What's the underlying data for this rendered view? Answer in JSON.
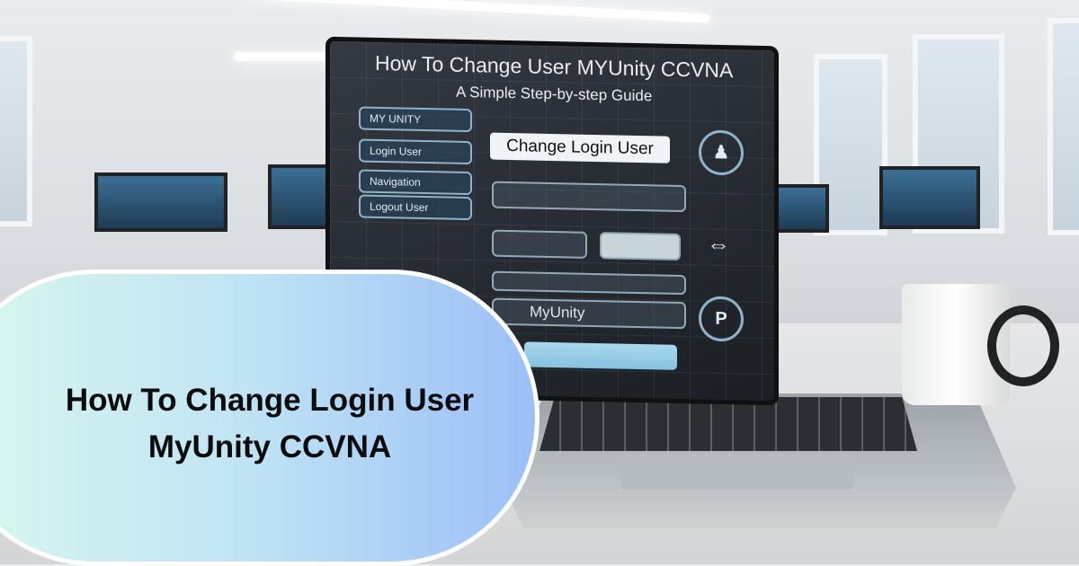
{
  "headline": {
    "line1": "How To Change Login User",
    "line2": "MyUnity CCVNA"
  },
  "laptop_screen": {
    "title": "How To Change User MYUnity CCVNA",
    "subtitle": "A Simple Step-by-step Guide",
    "sidebar": [
      "MY UNITY",
      "Login User",
      "Navigation",
      "Logout User"
    ],
    "main_label": "Change Login User",
    "brand_field": "MyUnity"
  },
  "colors": {
    "pill_left": "#d9f8ee",
    "pill_right": "#9cbff8",
    "text": "#0b0b0b",
    "screen": "#23272c"
  }
}
